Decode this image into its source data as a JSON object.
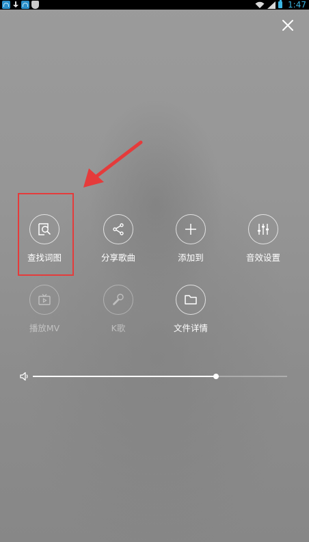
{
  "status_bar": {
    "time": "1:47",
    "icons": [
      "app-icon",
      "download-icon",
      "app-icon",
      "shield-icon",
      "wifi-icon",
      "signal-icon",
      "battery-icon"
    ]
  },
  "close": {
    "icon": "close-icon"
  },
  "menu": {
    "items": [
      {
        "label": "查找词图",
        "icon": "search-lyrics-icon",
        "enabled": true
      },
      {
        "label": "分享歌曲",
        "icon": "share-icon",
        "enabled": true
      },
      {
        "label": "添加到",
        "icon": "plus-icon",
        "enabled": true
      },
      {
        "label": "音效设置",
        "icon": "equalizer-icon",
        "enabled": true
      },
      {
        "label": "播放MV",
        "icon": "mv-icon",
        "enabled": false
      },
      {
        "label": "K歌",
        "icon": "microphone-icon",
        "enabled": false
      },
      {
        "label": "文件详情",
        "icon": "folder-icon",
        "enabled": true
      }
    ]
  },
  "volume": {
    "icon": "speaker-icon",
    "level": 0.72
  },
  "annotation": {
    "highlight_color": "#e53b3b"
  },
  "colors": {
    "accent": "#3cb6e3",
    "overlay": "#8f8f8f"
  }
}
